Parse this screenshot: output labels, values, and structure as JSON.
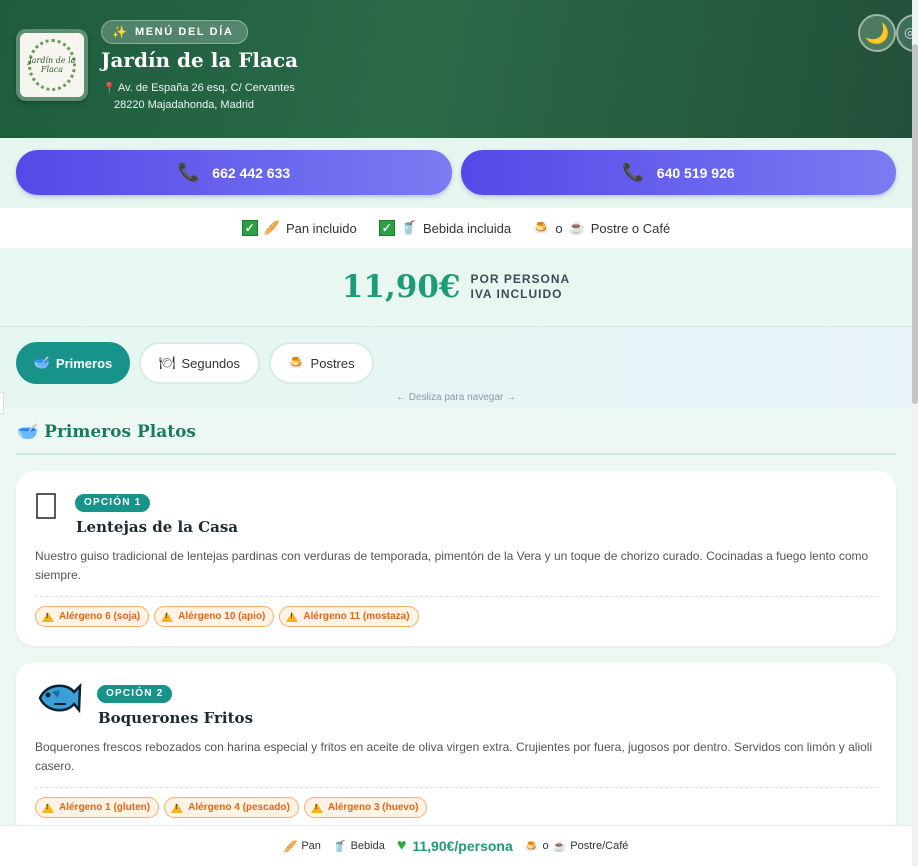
{
  "header": {
    "badge": "MENÚ DEL DÍA",
    "badge_icon": "✨",
    "restaurant_name": "Jardín de la Flaca",
    "logo_text": "Jardín de la Flaca",
    "address_line1": "Av. de España 26 esq. C/ Cervantes",
    "address_line2": "28220 Majadahonda, Madrid",
    "theme_icon": "🌙"
  },
  "phones": [
    {
      "number": "662 442 633"
    },
    {
      "number": "640 519 926"
    }
  ],
  "includes": {
    "bread": "Pan incluido",
    "drink": "Bebida incluida",
    "dessert_or": "o",
    "dessert": "Postre o Café"
  },
  "price": {
    "value": "11,90€",
    "label1": "POR PERSONA",
    "label2": "IVA INCLUIDO"
  },
  "tabs": [
    {
      "label": "Primeros",
      "icon": "🥣",
      "active": true
    },
    {
      "label": "Segundos",
      "icon": "🍽",
      "active": false
    },
    {
      "label": "Postres",
      "icon": "🍮",
      "active": false
    }
  ],
  "swipe_hint": "← Desliza para navegar →",
  "section": {
    "title": "Primeros Platos",
    "icon": "🥣"
  },
  "dishes": [
    {
      "option": "OPCIÓN 1",
      "name": "Lentejas de la Casa",
      "description": "Nuestro guiso tradicional de lentejas pardinas con verduras de temporada, pimentón de la Vera y un toque de chorizo curado. Cocinadas a fuego lento como siempre.",
      "allergens": [
        "Alérgeno 6 (soja)",
        "Alérgeno 10 (apio)",
        "Alérgeno 11 (mostaza)"
      ]
    },
    {
      "option": "OPCIÓN 2",
      "name": "Boquerones Fritos",
      "description": "Boquerones frescos rebozados con harina especial y fritos en aceite de oliva virgen extra. Crujientes por fuera, jugosos por dentro. Servidos con limón y alioli casero.",
      "allergens": [
        "Alérgeno 1 (gluten)",
        "Alérgeno 4 (pescado)",
        "Alérgeno 3 (huevo)"
      ]
    }
  ],
  "bottom_bar": {
    "bread": "Pan",
    "drink": "Bebida",
    "price": "11,90€/persona",
    "or": "o",
    "dessert": "Postre/Café"
  },
  "colors": {
    "header_green": "#1d5d3e",
    "accent_teal": "#17938a",
    "price_green": "#1e9b78",
    "phone_purple": "#5548e8",
    "allergen_orange": "#e0671a"
  }
}
